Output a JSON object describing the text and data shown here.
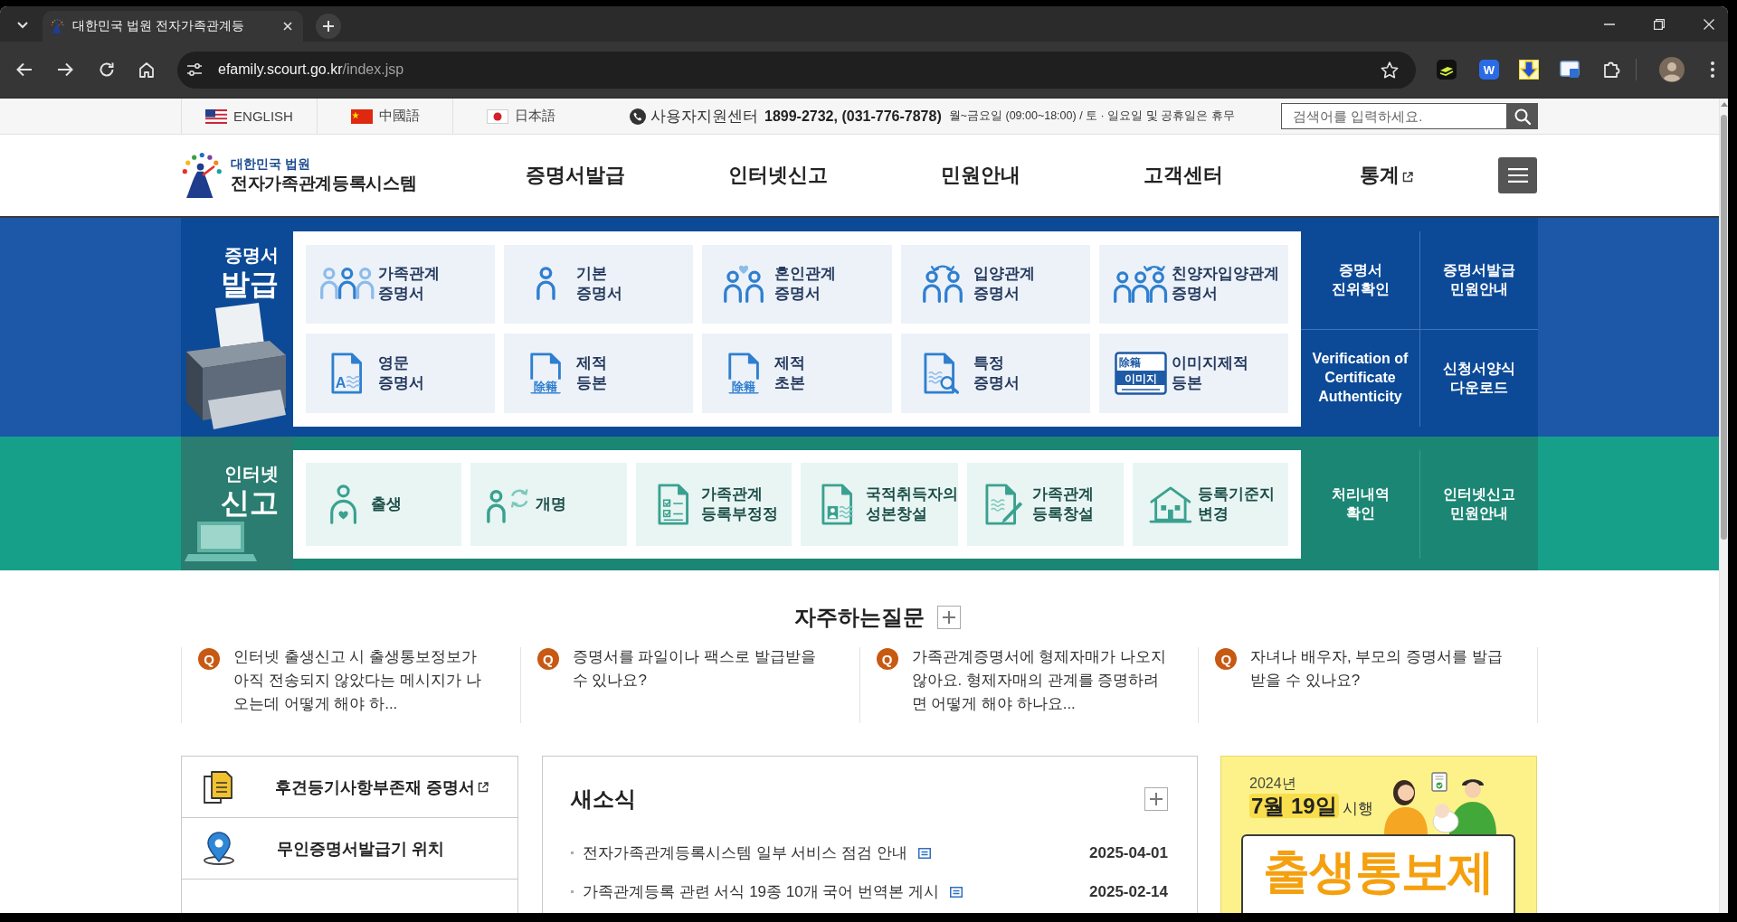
{
  "browser": {
    "tabs": [
      {
        "title": "대한민국 법원 전자가족관계등",
        "selected": true
      }
    ],
    "url_host": "efamily.scourt.go.kr",
    "url_path": "/index.jsp",
    "extension_letter": "W"
  },
  "utility_bar": {
    "languages": [
      {
        "label": "ENGLISH"
      },
      {
        "label": "中國語"
      },
      {
        "label": "日本語"
      }
    ],
    "support_label": "사용자지원센터",
    "support_phones": "1899-2732, (031-776-7878)",
    "support_hours": "월~금요일 (09:00~18:00) / 토 · 일요일 및 공휴일은 휴무",
    "search": {
      "placeholder": "검색어를 입력하세요."
    }
  },
  "header": {
    "org": "대한민국 법원",
    "system_name": "전자가족관계등록시스템",
    "nav": [
      {
        "label": "증명서발급",
        "external": false
      },
      {
        "label": "인터넷신고",
        "external": false
      },
      {
        "label": "민원안내",
        "external": false
      },
      {
        "label": "고객센터",
        "external": false
      },
      {
        "label": "통계",
        "external": true
      }
    ]
  },
  "bands": [
    {
      "kind": "certificate",
      "label": "증명서",
      "title": "발급",
      "tiles": [
        {
          "label": "가족관계 증명서"
        },
        {
          "label": "기본 증명서"
        },
        {
          "label": "혼인관계 증명서"
        },
        {
          "label": "입양관계 증명서"
        },
        {
          "label": "친양자입양관계 증명서"
        },
        {
          "label": "영문 증명서",
          "icon_text": [
            "A"
          ]
        },
        {
          "label": "제적 등본",
          "icon_text": [
            "除籍"
          ]
        },
        {
          "label": "제적 초본",
          "icon_text": [
            "除籍"
          ]
        },
        {
          "label": "특정 증명서"
        },
        {
          "label": "이미지제적 등본",
          "icon_text": [
            "除籍",
            "이미지"
          ]
        }
      ],
      "links": [
        {
          "label": "증명서\n진위확인"
        },
        {
          "label": "증명서발급\n민원안내"
        },
        {
          "label": "Verification of\nCertificate\nAuthenticity"
        },
        {
          "label": "신청서양식\n다운로드"
        }
      ]
    },
    {
      "kind": "report",
      "label": "인터넷",
      "title": "신고",
      "tiles": [
        {
          "label": "출생"
        },
        {
          "label": "개명"
        },
        {
          "label": "가족관계 등록부정정"
        },
        {
          "label": "국적취득자의 성본창설"
        },
        {
          "label": "가족관계 등록창설"
        },
        {
          "label": "등록기준지 변경"
        }
      ],
      "links": [
        {
          "label": "처리내역\n확인"
        },
        {
          "label": "인터넷신고\n민원안내"
        }
      ]
    }
  ],
  "faq": {
    "title": "자주하는질문",
    "items": [
      {
        "badge": "Q",
        "question": "인터넷 출생신고 시 출생통보정보가 아직 전송되지 않았다는 메시지가 나오는데 어떻게 해야 하..."
      },
      {
        "badge": "Q",
        "question": "증명서를 파일이나 팩스로 발급받을 수 있나요?"
      },
      {
        "badge": "Q",
        "question": "가족관계증명서에 형제자매가 나오지 않아요. 형제자매의 관계를 증명하려면 어떻게 해야 하나요..."
      },
      {
        "badge": "Q",
        "question": "자녀나 배우자, 부모의 증명서를 발급받을 수 있나요?"
      }
    ]
  },
  "quick_links": [
    {
      "label": "후견등기사항부존재 증명서",
      "external": true
    },
    {
      "label": "무인증명서발급기 위치",
      "external": false
    }
  ],
  "news": {
    "title": "새소식",
    "items": [
      {
        "title": "전자가족관계등록시스템 일부 서비스 점검 안내",
        "date": "2025-04-01"
      },
      {
        "title": "가족관계등록 관련 서식 19종 10개 국어 번역본 게시",
        "date": "2025-02-14"
      }
    ]
  },
  "banner": {
    "year": "2024년",
    "date": "**7월 19일** 시행",
    "title": "출생통보제"
  }
}
